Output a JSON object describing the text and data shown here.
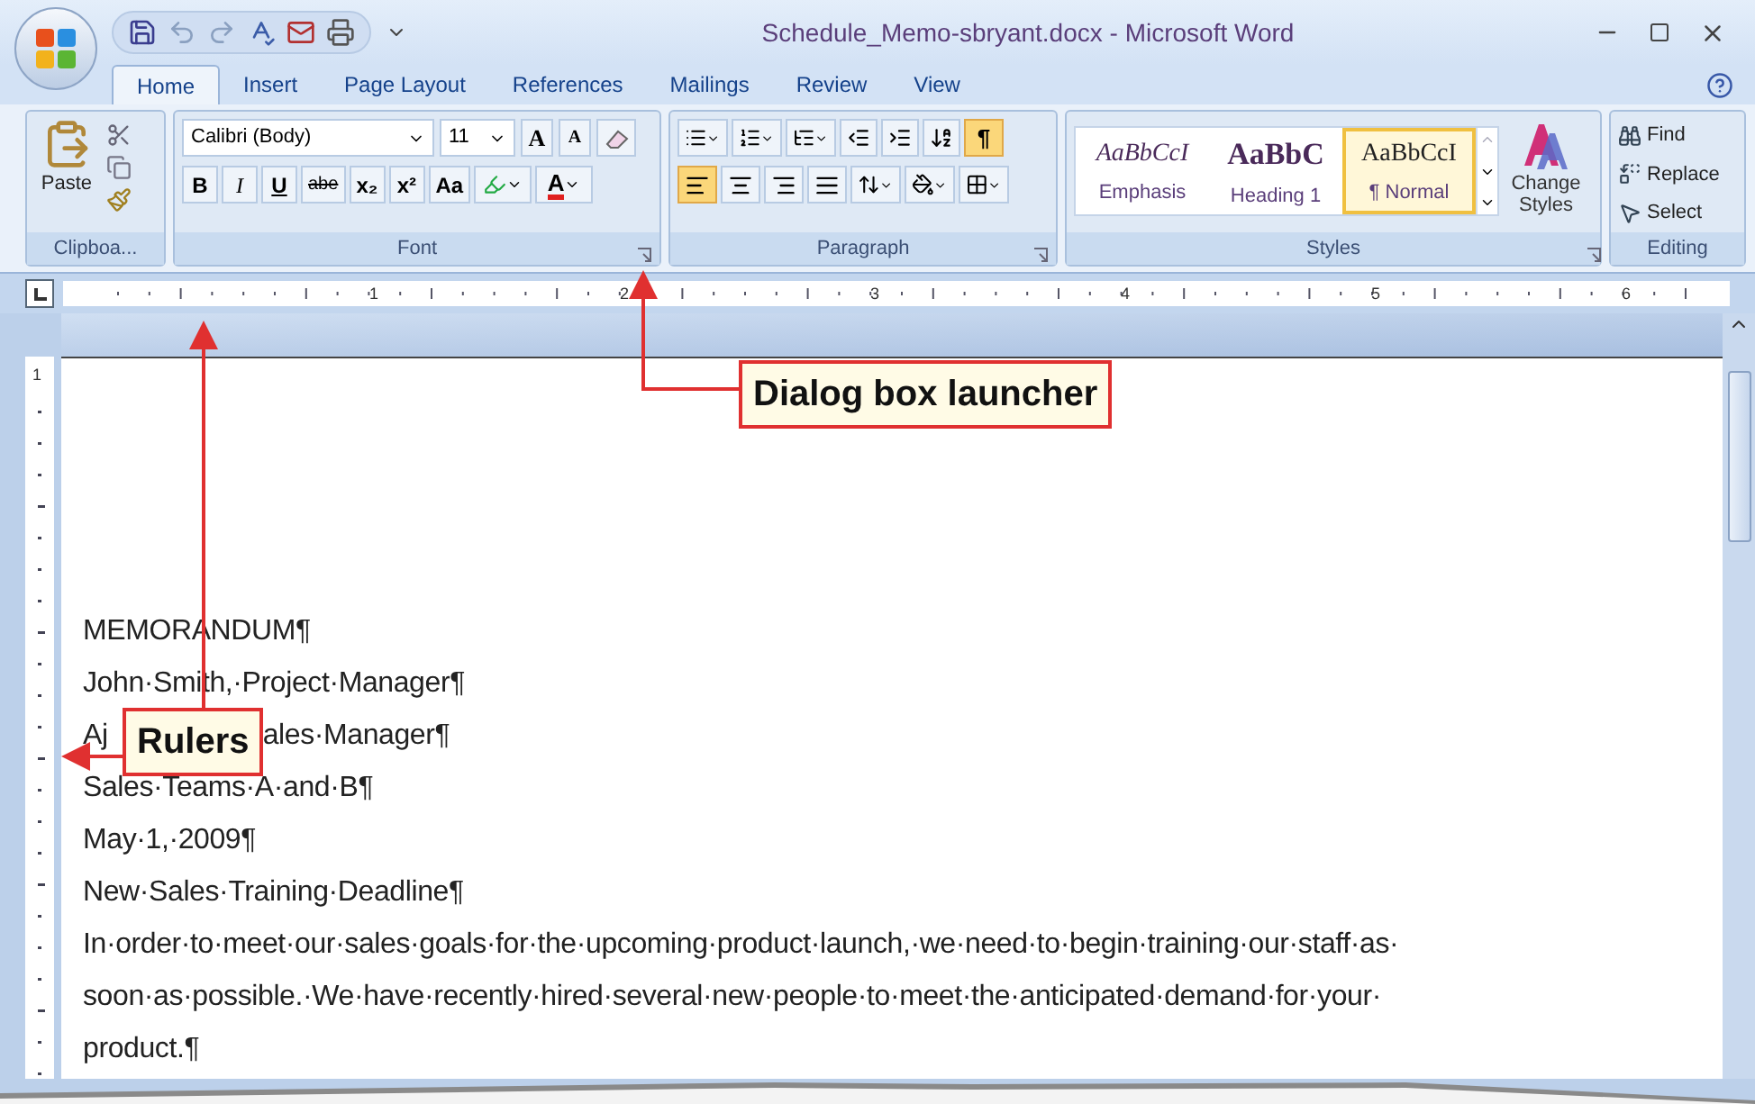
{
  "window": {
    "title": "Schedule_Memo-sbryant.docx - Microsoft Word"
  },
  "tabs": [
    {
      "label": "Home",
      "selected": true
    },
    {
      "label": "Insert",
      "selected": false
    },
    {
      "label": "Page Layout",
      "selected": false
    },
    {
      "label": "References",
      "selected": false
    },
    {
      "label": "Mailings",
      "selected": false
    },
    {
      "label": "Review",
      "selected": false
    },
    {
      "label": "View",
      "selected": false
    }
  ],
  "ribbon": {
    "clipboard": {
      "paste": "Paste",
      "label": "Clipboa..."
    },
    "font": {
      "name": "Calibri (Body)",
      "size": "11",
      "label": "Font",
      "grow": [
        {
          "glyph": "A",
          "kind": "grow"
        },
        {
          "glyph": "A",
          "kind": "shrink"
        }
      ],
      "format_buttons": [
        {
          "glyph": "B",
          "kind": "bold"
        },
        {
          "glyph": "I",
          "kind": "italic"
        },
        {
          "glyph": "U",
          "kind": "underline"
        },
        {
          "glyph": "abe",
          "kind": "strike"
        },
        {
          "glyph": "x₂",
          "kind": "sub"
        },
        {
          "glyph": "x²",
          "kind": "sup"
        },
        {
          "glyph": "Aa",
          "kind": "case"
        }
      ],
      "font_color": {
        "glyph": "A",
        "color": "#e02020"
      }
    },
    "paragraph": {
      "label": "Paragraph",
      "show_marks": {
        "glyph": "¶",
        "selected": true
      },
      "alignment": [
        {
          "kind": "left",
          "selected": true
        },
        {
          "kind": "center",
          "selected": false
        },
        {
          "kind": "right",
          "selected": false
        },
        {
          "kind": "justify",
          "selected": false
        }
      ]
    },
    "styles": {
      "label": "Styles",
      "change": "Change Styles",
      "items": [
        {
          "preview": "AaBbCcI",
          "label": "Emphasis",
          "kind": "emphasis",
          "selected": false
        },
        {
          "preview": "AaBbC",
          "label": "Heading 1",
          "kind": "heading",
          "selected": false
        },
        {
          "preview": "AaBbCcI",
          "label": "¶ Normal",
          "kind": "normal",
          "selected": true
        }
      ]
    },
    "editing": {
      "label": "Editing",
      "items": [
        {
          "label": "Find",
          "kind": "find"
        },
        {
          "label": "Replace",
          "kind": "replace"
        },
        {
          "label": "Select",
          "kind": "select"
        }
      ]
    }
  },
  "ruler": {
    "numbers": [
      "1",
      "2",
      "3",
      "4",
      "5",
      "6"
    ]
  },
  "vertical_ruler": {
    "numbers": [
      "1"
    ]
  },
  "document": {
    "lines": [
      {
        "parts": [
          "MEMORANDUM¶"
        ]
      },
      {
        "parts": [
          "John·Smith,·Project·Manager¶"
        ]
      },
      {
        "parts": [
          "Aj",
          "ales·Manager¶"
        ]
      },
      {
        "parts": [
          "Sales·Teams·A·and·B¶"
        ]
      },
      {
        "parts": [
          "May·1,·2009¶"
        ]
      },
      {
        "parts": [
          "New·Sales·Training·Deadline¶"
        ]
      },
      {
        "parts": [
          "In·order·to·meet·our·sales·goals·for·the·upcoming·product·launch,·we·need·to·begin·training·our·staff·as·"
        ]
      },
      {
        "parts": [
          "soon·as·possible.·We·have·recently·hired·several·new·people·to·meet·the·anticipated·demand·for·your·"
        ]
      },
      {
        "parts": [
          "product.¶"
        ]
      }
    ]
  },
  "callouts": [
    {
      "text": "Dialog box launcher",
      "kind": "launcher"
    },
    {
      "text": "Rulers",
      "kind": "rulers"
    }
  ]
}
